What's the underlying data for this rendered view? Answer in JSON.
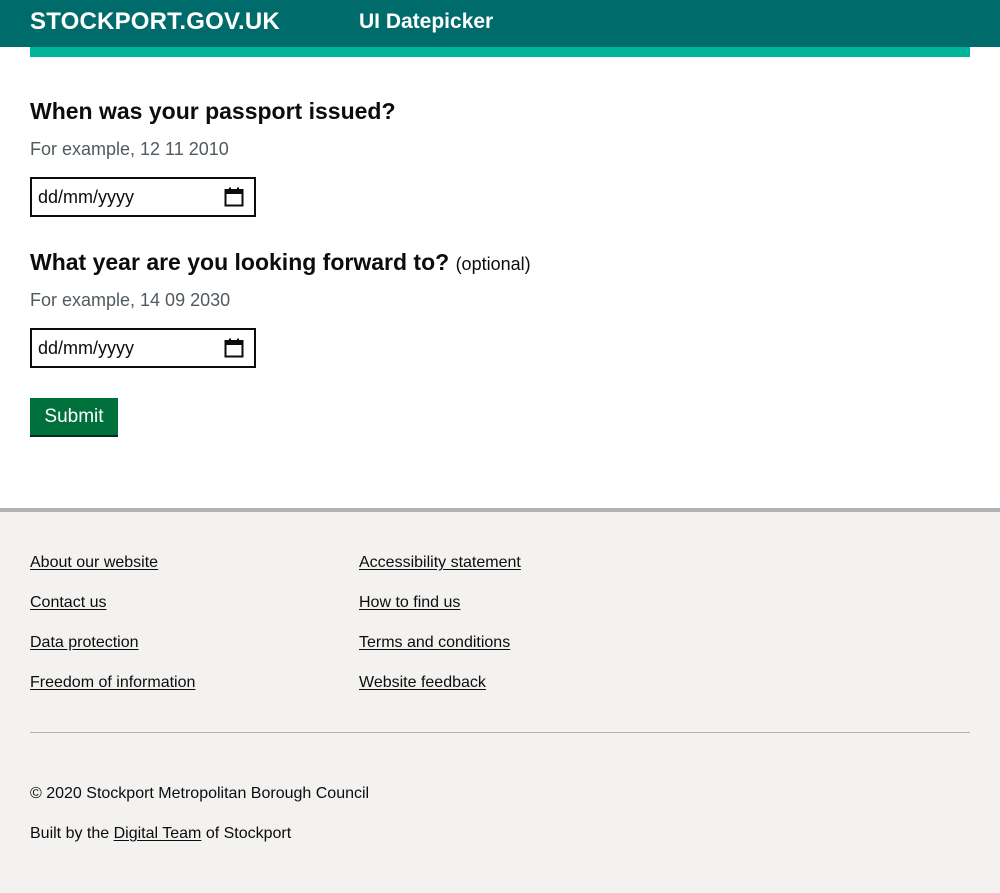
{
  "header": {
    "brand": "STOCKPORT.GOV.UK",
    "service_name": "UI Datepicker",
    "background_color": "#006b6b",
    "accent_color": "#00b39b"
  },
  "form": {
    "question1": {
      "label": "When was your passport issued?",
      "hint": "For example, 12 11 2010",
      "placeholder": "dd/mm/yyyy",
      "icon": "calendar-icon"
    },
    "question2": {
      "label": "What year are you looking forward to?",
      "optional": "(optional)",
      "hint": "For example, 14 09 2030",
      "placeholder": "dd/mm/yyyy",
      "icon": "calendar-icon"
    },
    "submit_label": "Submit",
    "submit_color": "#00703c"
  },
  "footer": {
    "links_col1": [
      "About our website",
      "Contact us",
      "Data protection",
      "Freedom of information"
    ],
    "links_col2": [
      "Accessibility statement",
      "How to find us",
      "Terms and conditions",
      "Website feedback"
    ],
    "copyright": "© 2020 Stockport Metropolitan Borough Council",
    "built_prefix": "Built by the",
    "built_link": "Digital Team",
    "built_suffix": "of Stockport"
  }
}
